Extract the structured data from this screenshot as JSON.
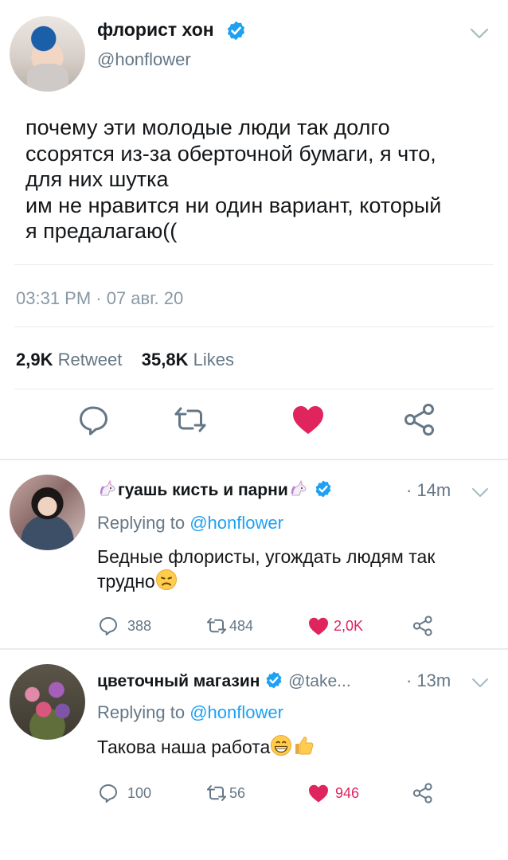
{
  "main_tweet": {
    "author_name": "флорист хон",
    "author_handle": "@honflower",
    "text": "почему эти молодые люди так долго\nссорятся из-за оберточной бумаги, я что,\nдля них шутка\nим не нравится ни один вариант, который\nя предалагаю((",
    "timestamp": "03:31 PM · 07 авг. 20",
    "retweets_count": "2,9K",
    "retweets_label": "Retweet",
    "likes_count": "35,8K",
    "likes_label": "Likes"
  },
  "replies": [
    {
      "author_name": "гуашь кисть и парни",
      "name_emoji": "unicorn-emoji",
      "verified": true,
      "time": "· 14m",
      "replying_prefix": "Replying to",
      "replying_handle": "@honflower",
      "text": "Бедные флористы, угождать людям так трудно",
      "text_emoji": "disappointed-face-emoji",
      "reply_count": "388",
      "retweet_count": "484",
      "like_count": "2,0K"
    },
    {
      "author_name": "цветочный магазин",
      "author_handle": "@take...",
      "verified": true,
      "time": "· 13m",
      "replying_prefix": "Replying to",
      "replying_handle": "@honflower",
      "text": "Такова наша работа",
      "text_emoji": "grinning-face-thumbs-up-emoji",
      "reply_count": "100",
      "retweet_count": "56",
      "like_count": "946"
    }
  ],
  "colors": {
    "text": "#14171a",
    "secondary": "#657786",
    "link": "#1da1f2",
    "like": "#e0245e",
    "divider": "#e6ecf0",
    "verified": "#1da1f2"
  }
}
